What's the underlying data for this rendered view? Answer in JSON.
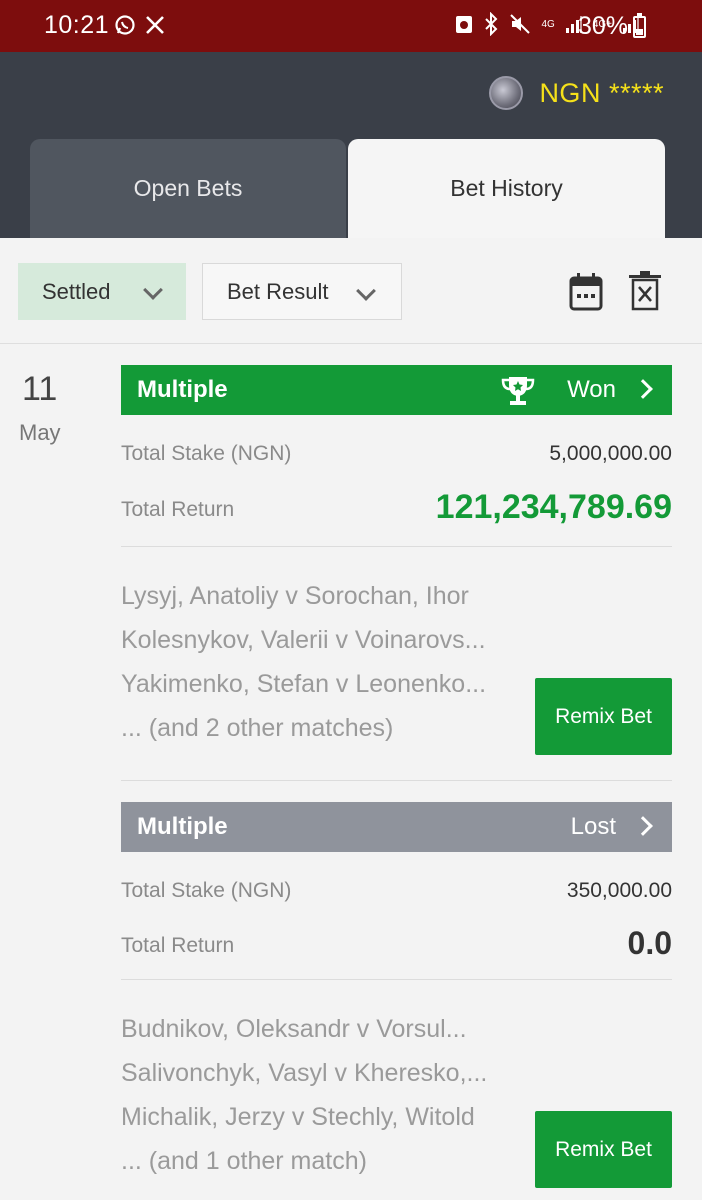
{
  "status_bar": {
    "time": "10:21",
    "network_4g": "4G",
    "network_4g_plus": "4G+",
    "battery_percent": "30%"
  },
  "header": {
    "currency": "NGN",
    "balance_masked": "*****",
    "tabs": [
      {
        "label": "Open Bets",
        "active": false
      },
      {
        "label": "Bet History",
        "active": true
      }
    ]
  },
  "filters": {
    "status_filter": "Settled",
    "result_filter": "Bet Result"
  },
  "date": {
    "day": "11",
    "month": "May"
  },
  "bets": [
    {
      "type": "Multiple",
      "result": "Won",
      "stake_label": "Total Stake (NGN)",
      "stake_value": "5,000,000.00",
      "return_label": "Total Return",
      "return_value": "121,234,789.69",
      "matches": [
        "Lysyj, Anatoliy v Sorochan, Ihor",
        "Kolesnykov, Valerii v Voinarovs...",
        "Yakimenko, Stefan v Leonenko...",
        "... (and 2 other matches)"
      ],
      "remix_label": "Remix Bet"
    },
    {
      "type": "Multiple",
      "result": "Lost",
      "stake_label": "Total Stake (NGN)",
      "stake_value": "350,000.00",
      "return_label": "Total Return",
      "return_value": "0.0",
      "matches": [
        "Budnikov, Oleksandr v Vorsul...",
        "Salivonchyk, Vasyl v Kheresko,...",
        "Michalik, Jerzy v Stechly, Witold",
        "... (and 1 other match)"
      ],
      "remix_label": "Remix Bet"
    }
  ],
  "colors": {
    "status_bar": "#7d0d0d",
    "header": "#3a3f48",
    "accent_green": "#139a37",
    "lost_grey": "#8f939c",
    "currency_yellow": "#f5e11a"
  }
}
